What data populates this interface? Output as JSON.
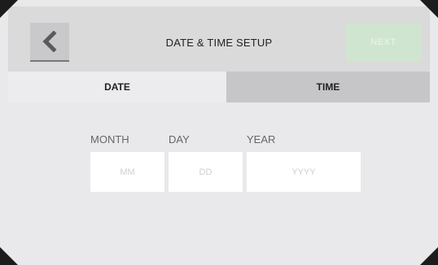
{
  "header": {
    "title": "DATE & TIME SETUP",
    "next_label": "NEXT",
    "back_icon": "chevron-left-icon"
  },
  "tabs": [
    {
      "label": "DATE",
      "active": true
    },
    {
      "label": "TIME",
      "active": false
    }
  ],
  "date_form": {
    "month": {
      "label": "MONTH",
      "placeholder": "MM",
      "value": ""
    },
    "day": {
      "label": "DAY",
      "placeholder": "DD",
      "value": ""
    },
    "year": {
      "label": "YEAR",
      "placeholder": "YYYY",
      "value": ""
    }
  },
  "colors": {
    "background": "#e9e9eb",
    "header": "#dadada",
    "next_disabled": "#cfe5cf",
    "tab_inactive": "#c6c6c8",
    "bezel": "#1c1c1c"
  }
}
